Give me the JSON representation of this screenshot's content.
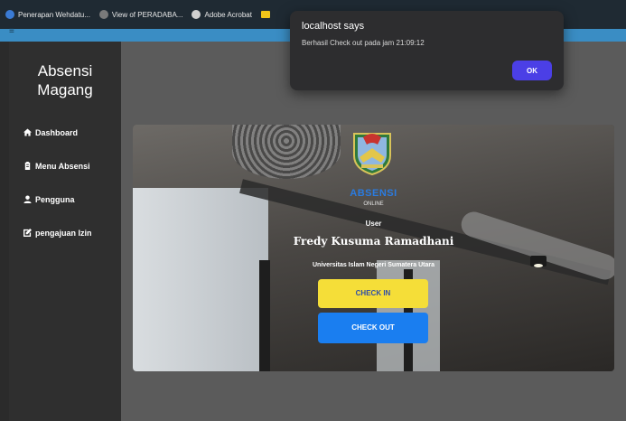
{
  "browser": {
    "bookmarks": [
      {
        "label": "Penerapan Wehdatu...",
        "icon": "site-icon",
        "color": "#3a7bd5"
      },
      {
        "label": "View of PERADABA...",
        "icon": "site-icon",
        "color": "#7a7a7a"
      },
      {
        "label": "Adobe Acrobat",
        "icon": "acrobat-icon",
        "color": "#d0d0d0"
      },
      {
        "label": "",
        "icon": "folder-icon",
        "color": "#f0c419"
      }
    ]
  },
  "sidebar": {
    "brand_line1": "Absensi",
    "brand_line2": "Magang",
    "items": [
      {
        "label": "Dashboard",
        "icon": "home-icon"
      },
      {
        "label": "Menu Absensi",
        "icon": "clipboard-icon"
      },
      {
        "label": "Pengguna",
        "icon": "user-icon"
      },
      {
        "label": "pengajuan Izin",
        "icon": "edit-icon"
      }
    ]
  },
  "hero": {
    "app_title": "ABSENSI",
    "app_subtitle": "ONLINE",
    "role": "User",
    "name": "Fredy Kusuma Ramadhani",
    "institution": "Universitas Islam Negeri Sumatera Utara",
    "check_in_label": "CHECK IN",
    "check_out_label": "CHECK OUT"
  },
  "dialog": {
    "title": "localhost says",
    "message": "Berhasil Check out pada jam 21:09:12",
    "ok_label": "OK"
  },
  "colors": {
    "accent": "#3a8dc4",
    "check_in": "#f5de38",
    "check_out": "#1a7ef0",
    "dialog_ok": "#4b3fe6"
  }
}
